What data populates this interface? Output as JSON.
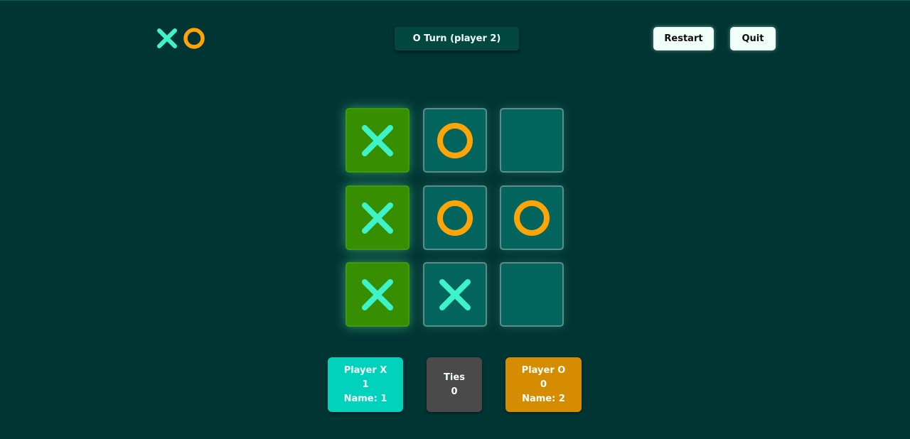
{
  "header": {
    "logo_icons": [
      "x-mark-icon",
      "o-mark-icon"
    ],
    "turn_text": "O Turn (player 2)",
    "restart_label": "Restart",
    "quit_label": "Quit"
  },
  "board": {
    "cells": [
      "X",
      "O",
      "",
      "X",
      "O",
      "O",
      "X",
      "X",
      ""
    ],
    "winning_cells": [
      0,
      3,
      6
    ]
  },
  "scores": {
    "player_x": {
      "title": "Player X",
      "value": "1",
      "name": "Name: 1"
    },
    "ties": {
      "title": "Ties",
      "value": "0"
    },
    "player_o": {
      "title": "Player O",
      "value": "0",
      "name": "Name: 2"
    }
  },
  "colors": {
    "background": "#003533",
    "x_mark": "#3ff3c9",
    "o_mark": "#ffa407",
    "win_cell": "#368e00",
    "cell": "#03655d",
    "player_x_card": "#00d2bb",
    "ties_card": "#4a4a4a",
    "player_o_card": "#d58c00"
  }
}
